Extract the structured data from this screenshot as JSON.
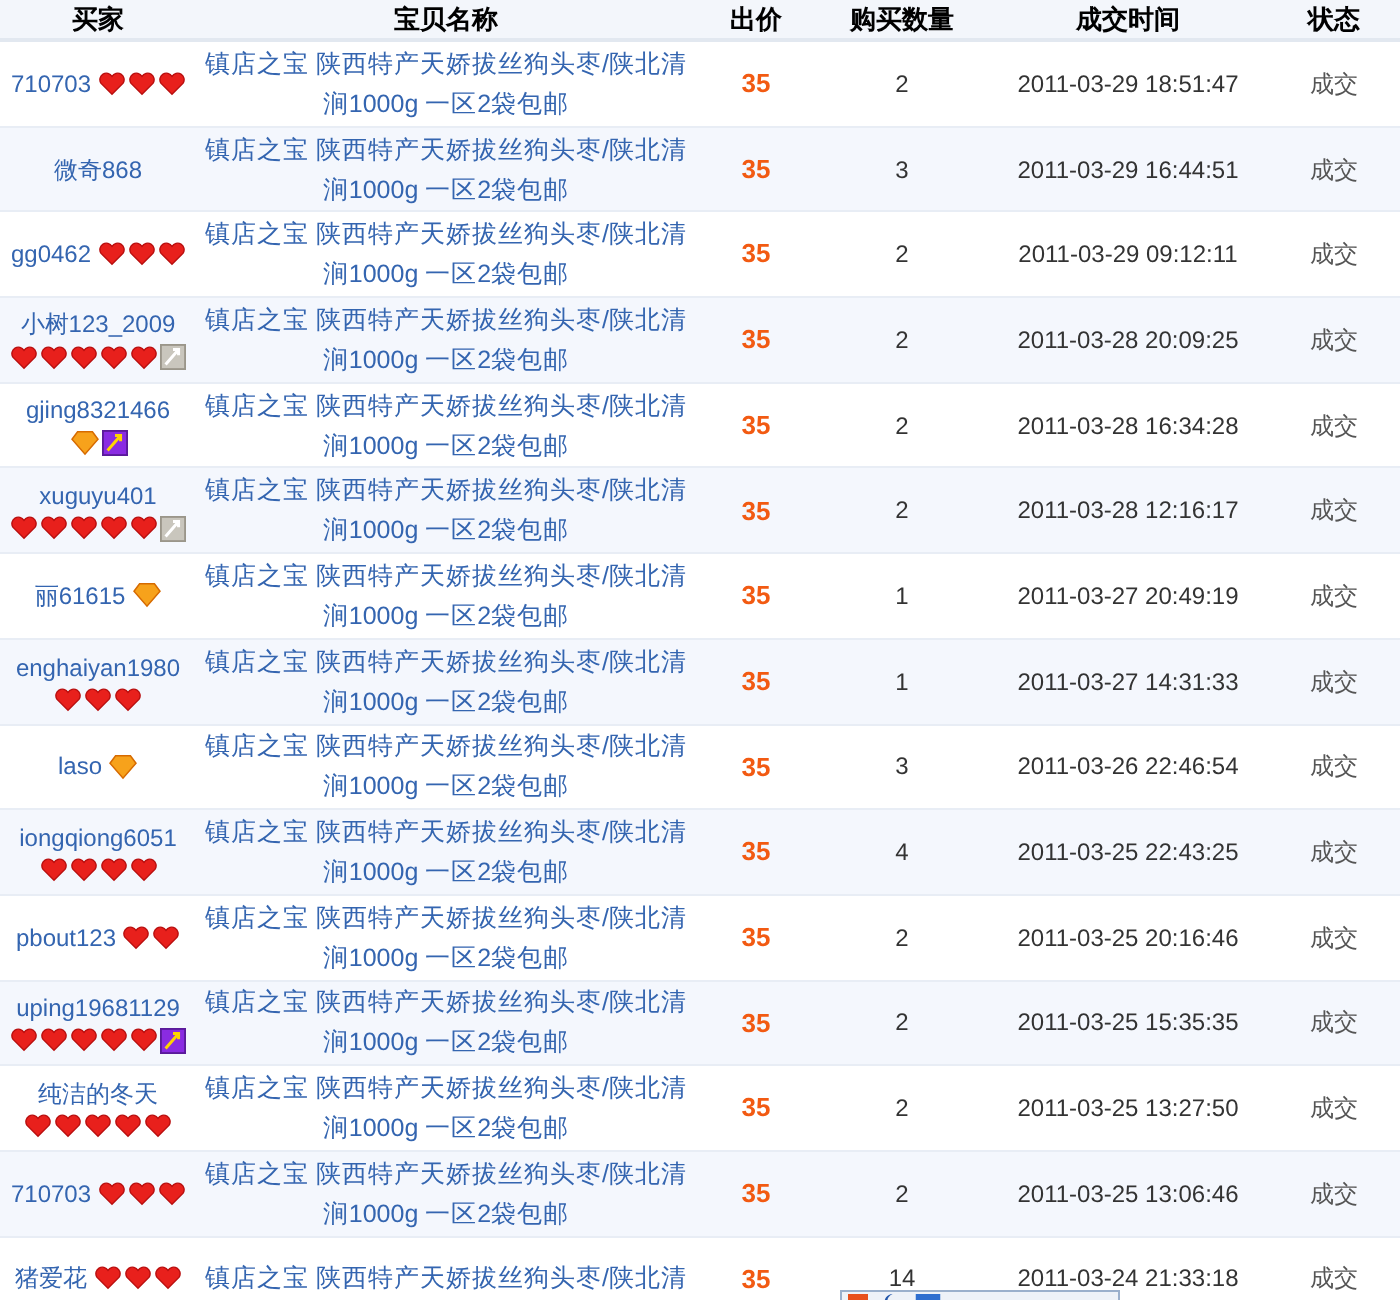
{
  "table": {
    "columns": [
      "买家",
      "宝贝名称",
      "出价",
      "购买数量",
      "成交时间",
      "状态"
    ],
    "rows": [
      {
        "buyer": "710703",
        "icons": [
          {
            "kind": "heart"
          },
          {
            "kind": "heart"
          },
          {
            "kind": "heart"
          }
        ],
        "item": "镇店之宝 陕西特产天娇拔丝狗头枣/陕北清涧1000g 一区2袋包邮",
        "price": "35",
        "quantity": "2",
        "time": "2011-03-29 18:51:47",
        "status": "成交"
      },
      {
        "buyer": "微奇868",
        "icons": [],
        "item": "镇店之宝 陕西特产天娇拔丝狗头枣/陕北清涧1000g 一区2袋包邮",
        "price": "35",
        "quantity": "3",
        "time": "2011-03-29 16:44:51",
        "status": "成交"
      },
      {
        "buyer": "gg0462",
        "icons": [
          {
            "kind": "heart"
          },
          {
            "kind": "heart"
          },
          {
            "kind": "heart"
          }
        ],
        "item": "镇店之宝 陕西特产天娇拔丝狗头枣/陕北清涧1000g 一区2袋包邮",
        "price": "35",
        "quantity": "2",
        "time": "2011-03-29 09:12:11",
        "status": "成交"
      },
      {
        "buyer": "小树123_2009",
        "icons": [
          {
            "kind": "heart"
          },
          {
            "kind": "heart"
          },
          {
            "kind": "heart"
          },
          {
            "kind": "heart"
          },
          {
            "kind": "heart"
          },
          {
            "kind": "grey_badge"
          }
        ],
        "item": "镇店之宝 陕西特产天娇拔丝狗头枣/陕北清涧1000g 一区2袋包邮",
        "price": "35",
        "quantity": "2",
        "time": "2011-03-28 20:09:25",
        "status": "成交"
      },
      {
        "buyer": "gjing8321466",
        "icons": [
          {
            "kind": "diamond"
          },
          {
            "kind": "purple_badge"
          }
        ],
        "item": "镇店之宝 陕西特产天娇拔丝狗头枣/陕北清涧1000g 一区2袋包邮",
        "price": "35",
        "quantity": "2",
        "time": "2011-03-28 16:34:28",
        "status": "成交"
      },
      {
        "buyer": "xuguyu401",
        "icons": [
          {
            "kind": "heart"
          },
          {
            "kind": "heart"
          },
          {
            "kind": "heart"
          },
          {
            "kind": "heart"
          },
          {
            "kind": "heart"
          },
          {
            "kind": "grey_badge"
          }
        ],
        "item": "镇店之宝 陕西特产天娇拔丝狗头枣/陕北清涧1000g 一区2袋包邮",
        "price": "35",
        "quantity": "2",
        "time": "2011-03-28 12:16:17",
        "status": "成交"
      },
      {
        "buyer": "丽61615",
        "icons": [
          {
            "kind": "diamond"
          }
        ],
        "item": "镇店之宝 陕西特产天娇拔丝狗头枣/陕北清涧1000g 一区2袋包邮",
        "price": "35",
        "quantity": "1",
        "time": "2011-03-27 20:49:19",
        "status": "成交"
      },
      {
        "buyer": "enghaiyan1980",
        "icons": [
          {
            "kind": "heart"
          },
          {
            "kind": "heart"
          },
          {
            "kind": "heart"
          }
        ],
        "item": "镇店之宝 陕西特产天娇拔丝狗头枣/陕北清涧1000g 一区2袋包邮",
        "price": "35",
        "quantity": "1",
        "time": "2011-03-27 14:31:33",
        "status": "成交"
      },
      {
        "buyer": "laso",
        "icons": [
          {
            "kind": "diamond"
          }
        ],
        "item": "镇店之宝 陕西特产天娇拔丝狗头枣/陕北清涧1000g 一区2袋包邮",
        "price": "35",
        "quantity": "3",
        "time": "2011-03-26 22:46:54",
        "status": "成交"
      },
      {
        "buyer": "iongqiong6051",
        "icons": [
          {
            "kind": "heart"
          },
          {
            "kind": "heart"
          },
          {
            "kind": "heart"
          },
          {
            "kind": "heart"
          }
        ],
        "item": "镇店之宝 陕西特产天娇拔丝狗头枣/陕北清涧1000g 一区2袋包邮",
        "price": "35",
        "quantity": "4",
        "time": "2011-03-25 22:43:25",
        "status": "成交"
      },
      {
        "buyer": "pbout123",
        "icons": [
          {
            "kind": "heart"
          },
          {
            "kind": "heart"
          }
        ],
        "item": "镇店之宝 陕西特产天娇拔丝狗头枣/陕北清涧1000g 一区2袋包邮",
        "price": "35",
        "quantity": "2",
        "time": "2011-03-25 20:16:46",
        "status": "成交"
      },
      {
        "buyer": "uping19681129",
        "icons": [
          {
            "kind": "heart"
          },
          {
            "kind": "heart"
          },
          {
            "kind": "heart"
          },
          {
            "kind": "heart"
          },
          {
            "kind": "heart"
          },
          {
            "kind": "purple_badge"
          }
        ],
        "item": "镇店之宝 陕西特产天娇拔丝狗头枣/陕北清涧1000g 一区2袋包邮",
        "price": "35",
        "quantity": "2",
        "time": "2011-03-25 15:35:35",
        "status": "成交"
      },
      {
        "buyer": "纯洁的冬天",
        "icons": [
          {
            "kind": "heart"
          },
          {
            "kind": "heart"
          },
          {
            "kind": "heart"
          },
          {
            "kind": "heart"
          },
          {
            "kind": "heart"
          }
        ],
        "item": "镇店之宝 陕西特产天娇拔丝狗头枣/陕北清涧1000g 一区2袋包邮",
        "price": "35",
        "quantity": "2",
        "time": "2011-03-25 13:27:50",
        "status": "成交"
      },
      {
        "buyer": "710703",
        "icons": [
          {
            "kind": "heart"
          },
          {
            "kind": "heart"
          },
          {
            "kind": "heart"
          }
        ],
        "item": "镇店之宝 陕西特产天娇拔丝狗头枣/陕北清涧1000g 一区2袋包邮",
        "price": "35",
        "quantity": "2",
        "time": "2011-03-25 13:06:46",
        "status": "成交"
      },
      {
        "buyer": "猪爱花",
        "icons": [
          {
            "kind": "heart"
          },
          {
            "kind": "heart"
          },
          {
            "kind": "heart"
          }
        ],
        "item": "镇店之宝 陕西特产天娇拔丝狗头枣/陕北清",
        "price": "35",
        "quantity": "14",
        "time": "2011-03-24 21:33:18",
        "status": "成交"
      }
    ]
  }
}
